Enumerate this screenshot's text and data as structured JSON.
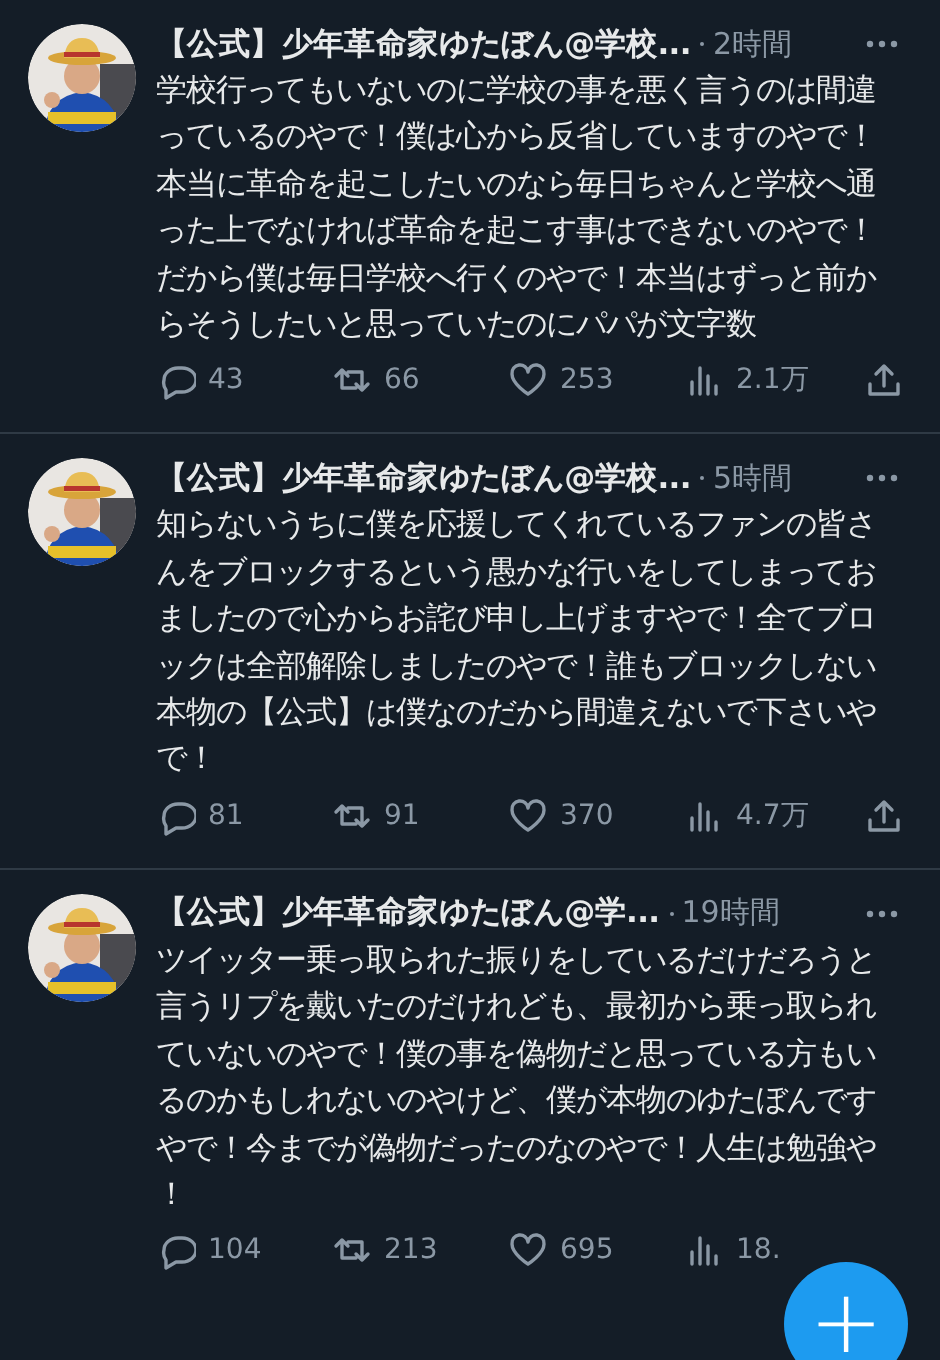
{
  "tweets": [
    {
      "name": "【公式】少年革命家ゆたぼん@学校...",
      "time": "2時間",
      "text": "学校行ってもいないのに学校の事を悪く言うのは間違っているのやで！僕は心から反省していますのやで！本当に革命を起こしたいのなら毎日ちゃんと学校へ通った上でなければ革命を起こす事はできないのやで！だから僕は毎日学校へ行くのやで！本当はずっと前からそうしたいと思っていたのにパパが文字数",
      "replies": "43",
      "retweets": "66",
      "likes": "253",
      "views": "2.1万",
      "share_icon": true
    },
    {
      "name": "【公式】少年革命家ゆたぼん@学校...",
      "time": "5時間",
      "text": "知らないうちに僕を応援してくれているファンの皆さんをブロックするという愚かな行いをしてしまっておましたので心からお詫び申し上げますやで！全てブロックは全部解除しましたのやで！誰もブロックしない本物の【公式】は僕なのだから間違えないで下さいやで！",
      "replies": "81",
      "retweets": "91",
      "likes": "370",
      "views": "4.7万",
      "share_icon": true
    },
    {
      "name": "【公式】少年革命家ゆたぼん@学...",
      "time": "19時間",
      "text": "ツイッター乗っ取られた振りをしているだけだろうと言うリプを戴いたのだけれども、最初から乗っ取られていないのやで！僕の事を偽物だと思っている方もいるのかもしれないのやけど、僕が本物のゆたぼんですやで！今までが偽物だったのなのやで！人生は勉強や！",
      "replies": "104",
      "retweets": "213",
      "likes": "695",
      "views": "18.",
      "share_icon": false
    }
  ],
  "compose_button": {
    "label": "+"
  }
}
